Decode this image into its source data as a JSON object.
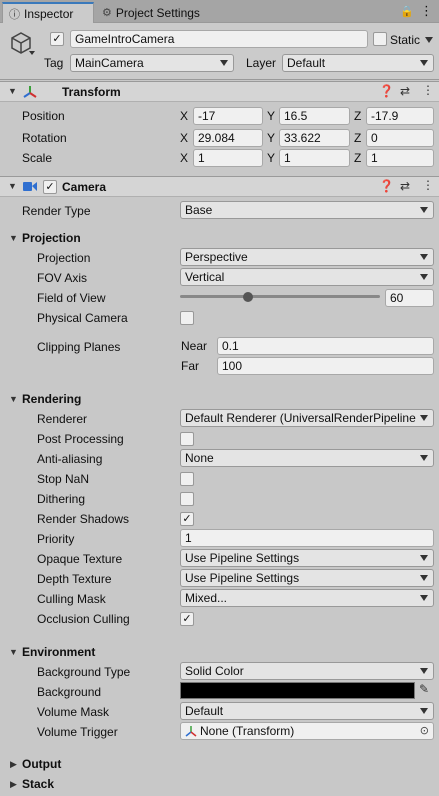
{
  "tabs": [
    {
      "label": "Inspector",
      "icon": "info-icon"
    },
    {
      "label": "Project Settings",
      "icon": "gear-icon"
    }
  ],
  "object": {
    "name": "GameIntroCamera",
    "static_label": "Static",
    "tag_label": "Tag",
    "tag_value": "MainCamera",
    "layer_label": "Layer",
    "layer_value": "Default"
  },
  "transform": {
    "title": "Transform",
    "rows": [
      {
        "label": "Position",
        "x": "-17",
        "y": "16.5",
        "z": "-17.9"
      },
      {
        "label": "Rotation",
        "x": "29.084",
        "y": "33.622",
        "z": "0"
      },
      {
        "label": "Scale",
        "x": "1",
        "y": "1",
        "z": "1"
      }
    ],
    "axes": [
      "X",
      "Y",
      "Z"
    ]
  },
  "camera": {
    "title": "Camera",
    "render_type_label": "Render Type",
    "render_type_value": "Base",
    "projection": {
      "section": "Projection",
      "projection_label": "Projection",
      "projection_value": "Perspective",
      "fov_axis_label": "FOV Axis",
      "fov_axis_value": "Vertical",
      "fov_label": "Field of View",
      "fov_value": "60",
      "fov_slider_fraction": 0.33,
      "physical_label": "Physical Camera",
      "clipping_label": "Clipping Planes",
      "near_label": "Near",
      "near_value": "0.1",
      "far_label": "Far",
      "far_value": "100"
    },
    "rendering": {
      "section": "Rendering",
      "renderer_label": "Renderer",
      "renderer_value": "Default Renderer (UniversalRenderPipeline",
      "post_label": "Post Processing",
      "aa_label": "Anti-aliasing",
      "aa_value": "None",
      "nan_label": "Stop NaN",
      "dither_label": "Dithering",
      "shadows_label": "Render Shadows",
      "priority_label": "Priority",
      "priority_value": "1",
      "opaque_label": "Opaque Texture",
      "opaque_value": "Use Pipeline Settings",
      "depth_label": "Depth Texture",
      "depth_value": "Use Pipeline Settings",
      "culling_label": "Culling Mask",
      "culling_value": "Mixed...",
      "occlusion_label": "Occlusion Culling"
    },
    "environment": {
      "section": "Environment",
      "bgtype_label": "Background Type",
      "bgtype_value": "Solid Color",
      "bg_label": "Background",
      "bg_color": "#000000",
      "volmask_label": "Volume Mask",
      "volmask_value": "Default",
      "voltrigger_label": "Volume Trigger",
      "voltrigger_value": "None (Transform)"
    },
    "output_label": "Output",
    "stack_label": "Stack"
  },
  "colors": {
    "accent": "#3a79bb",
    "panel": "#c8c8c8"
  }
}
